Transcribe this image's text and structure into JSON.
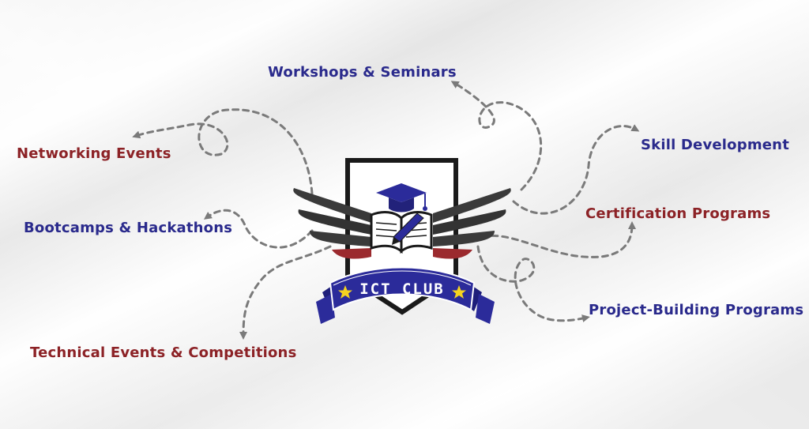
{
  "colors": {
    "blue": "#2a2a8c",
    "red": "#8c2226",
    "arrow": "#7a7a7a",
    "wing": "#3a3a3a",
    "banner": "#2b2b9a",
    "star": "#f5d320"
  },
  "logo": {
    "banner_text": "ICT CLUB",
    "icons": [
      "graduation-cap-icon",
      "open-book-icon",
      "pencil-icon",
      "star-icon"
    ]
  },
  "items": [
    {
      "id": "workshops",
      "label": "Workshops & Seminars",
      "color": "blue"
    },
    {
      "id": "networking",
      "label": "Networking Events",
      "color": "red"
    },
    {
      "id": "skill",
      "label": "Skill Development",
      "color": "blue"
    },
    {
      "id": "bootcamps",
      "label": "Bootcamps & Hackathons",
      "color": "blue"
    },
    {
      "id": "certification",
      "label": "Certification Programs",
      "color": "red"
    },
    {
      "id": "project",
      "label": "Project-Building Programs",
      "color": "blue"
    },
    {
      "id": "technical",
      "label": "Technical Events & Competitions",
      "color": "red"
    }
  ]
}
